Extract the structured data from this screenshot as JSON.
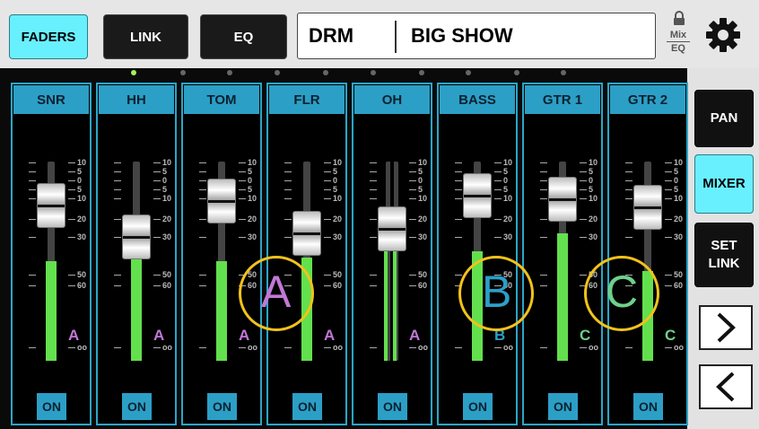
{
  "topbar": {
    "faders_label": "FADERS",
    "link_label": "LINK",
    "eq_label": "EQ",
    "show_short": "DRM",
    "show_name": "BIG SHOW",
    "mix_label": "Mix",
    "eq_small_label": "EQ"
  },
  "colors": {
    "accent": "#68f0ff",
    "strip_header": "#2c9fc6",
    "meter": "#63e04d",
    "link_a": "#c277d6",
    "link_b": "#2c9fc6",
    "link_c": "#6ed08a",
    "ring": "#f2c21b"
  },
  "scale_labels": [
    "10",
    "5",
    "0",
    "5",
    "10",
    "20",
    "30",
    "50",
    "60",
    "oo"
  ],
  "channels": [
    {
      "name": "SNR",
      "on_label": "ON",
      "link": "A",
      "fader_level": 0.78,
      "meter_level": 0.5
    },
    {
      "name": "HH",
      "on_label": "ON",
      "link": "A",
      "fader_level": 0.62,
      "meter_level": 0.58
    },
    {
      "name": "TOM",
      "on_label": "ON",
      "link": "A",
      "fader_level": 0.8,
      "meter_level": 0.5
    },
    {
      "name": "FLR",
      "on_label": "ON",
      "link": "A",
      "fader_level": 0.64,
      "meter_level": 0.52
    },
    {
      "name": "OH",
      "on_label": "ON",
      "link": "A",
      "fader_level": 0.66,
      "meter_level": 0.62
    },
    {
      "name": "BASS",
      "on_label": "ON",
      "link": "B",
      "fader_level": 0.83,
      "meter_level": 0.55
    },
    {
      "name": "GTR 1",
      "on_label": "ON",
      "link": "C",
      "fader_level": 0.81,
      "meter_level": 0.64
    },
    {
      "name": "GTR 2",
      "on_label": "ON",
      "link": "C",
      "fader_level": 0.77,
      "meter_level": 0.45
    }
  ],
  "side": {
    "pan_label": "PAN",
    "mixer_label": "MIXER",
    "set_link_label": "SET\nLINK"
  },
  "annotations": [
    "A",
    "B",
    "C"
  ],
  "icons": [
    "lock-icon",
    "gear-icon",
    "chevron-right-icon",
    "chevron-left-icon"
  ]
}
